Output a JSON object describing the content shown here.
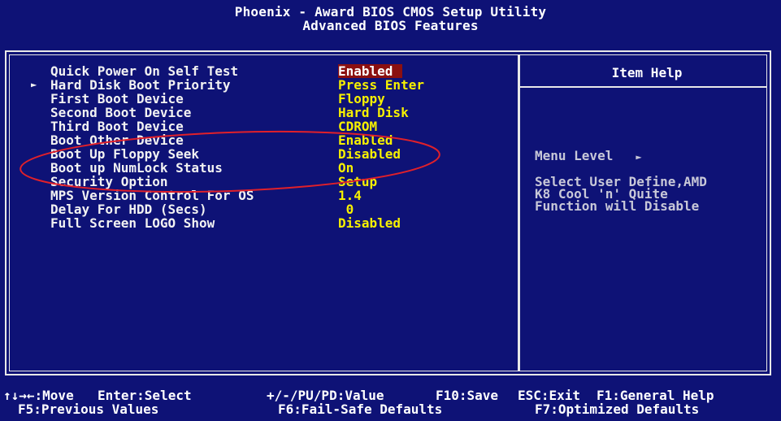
{
  "header": {
    "line1": "Phoenix - Award BIOS CMOS Setup Utility",
    "line2": "Advanced BIOS Features"
  },
  "settings": [
    {
      "label": "Quick Power On Self Test",
      "value": "Enabled",
      "selected": true,
      "submenu": false
    },
    {
      "label": "Hard Disk Boot Priority",
      "value": "Press Enter",
      "selected": false,
      "submenu": true
    },
    {
      "label": "First Boot Device",
      "value": "Floppy",
      "selected": false,
      "submenu": false
    },
    {
      "label": "Second Boot Device",
      "value": "Hard Disk",
      "selected": false,
      "submenu": false
    },
    {
      "label": "Third Boot Device",
      "value": "CDROM",
      "selected": false,
      "submenu": false
    },
    {
      "label": "Boot Other Device",
      "value": "Enabled",
      "selected": false,
      "submenu": false
    },
    {
      "label": "Boot Up Floppy Seek",
      "value": "Disabled",
      "selected": false,
      "submenu": false
    },
    {
      "label": "Boot up NumLock Status",
      "value": "On",
      "selected": false,
      "submenu": false
    },
    {
      "label": "Security Option",
      "value": "Setup",
      "selected": false,
      "submenu": false
    },
    {
      "label": "MPS Version Control For OS",
      "value": "1.4",
      "selected": false,
      "submenu": false
    },
    {
      "label": "Delay For HDD (Secs)",
      "value": " 0",
      "selected": false,
      "submenu": false
    },
    {
      "label": "Full Screen LOGO Show",
      "value": "Disabled",
      "selected": false,
      "submenu": false
    }
  ],
  "help": {
    "title": "Item Help",
    "menu_level_label": "Menu Level",
    "menu_level_arrow": "►",
    "text": "Select User Define,AMD\nK8 Cool 'n' Quite\nFunction will Disable"
  },
  "footer": {
    "move": "↑↓→←:Move",
    "enter": "Enter:Select",
    "value": "+/-/PU/PD:Value",
    "save": "F10:Save",
    "exit": "ESC:Exit",
    "help": "F1:General Help",
    "previous": "F5:Previous Values",
    "failsafe": "F6:Fail-Safe Defaults",
    "optimized": "F7:Optimized Defaults"
  },
  "colors": {
    "background": "#0e1276",
    "value": "#f6f000",
    "selected_bg": "#8b1010",
    "annotation": "#e0202a"
  }
}
